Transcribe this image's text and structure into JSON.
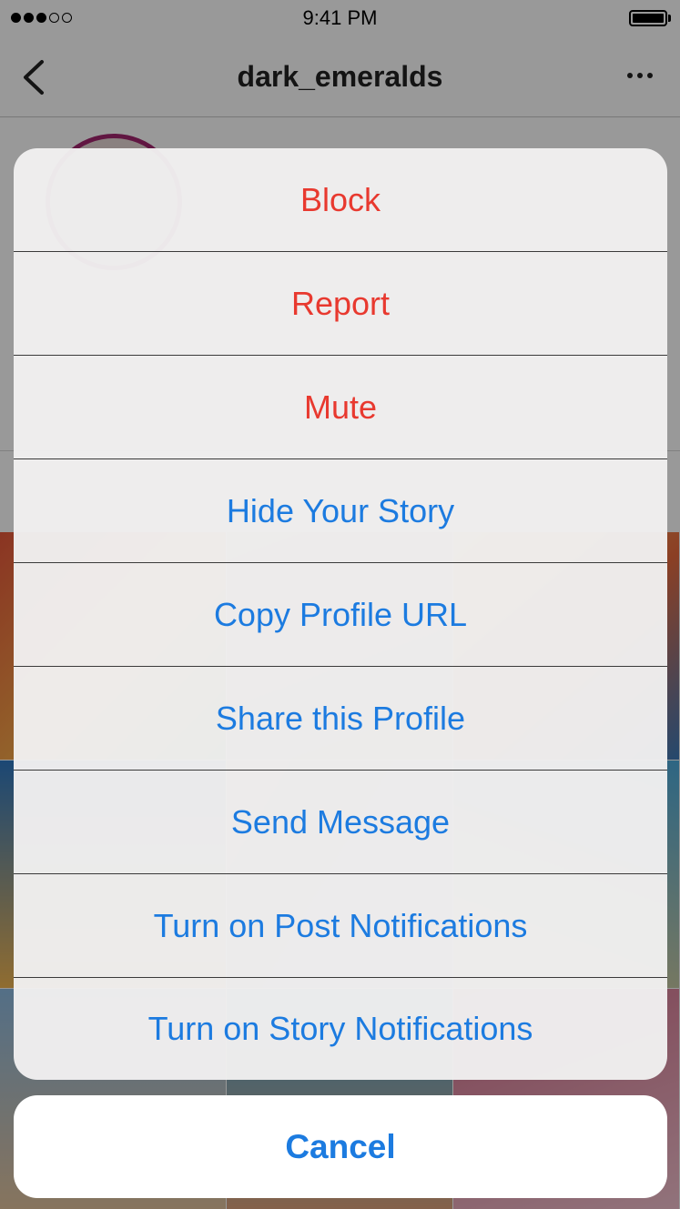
{
  "status_bar": {
    "time": "9:41 PM",
    "signal_bars_filled": 3,
    "signal_bars_total": 5
  },
  "nav": {
    "title": "dark_emeralds",
    "back_icon": "chevron-left-icon",
    "more_icon": "more-horizontal-icon"
  },
  "action_sheet": {
    "items": [
      {
        "label": "Block",
        "style": "destructive"
      },
      {
        "label": "Report",
        "style": "destructive"
      },
      {
        "label": "Mute",
        "style": "destructive"
      },
      {
        "label": "Hide Your Story",
        "style": "default"
      },
      {
        "label": "Copy Profile URL",
        "style": "default"
      },
      {
        "label": "Share this Profile",
        "style": "default"
      },
      {
        "label": "Send Message",
        "style": "default"
      },
      {
        "label": "Turn on Post Notifications",
        "style": "default"
      },
      {
        "label": "Turn on Story Notifications",
        "style": "default"
      }
    ],
    "cancel_label": "Cancel"
  },
  "colors": {
    "destructive": "#e8392f",
    "accent": "#1c7be0",
    "avatar_ring": "#a2266f"
  }
}
